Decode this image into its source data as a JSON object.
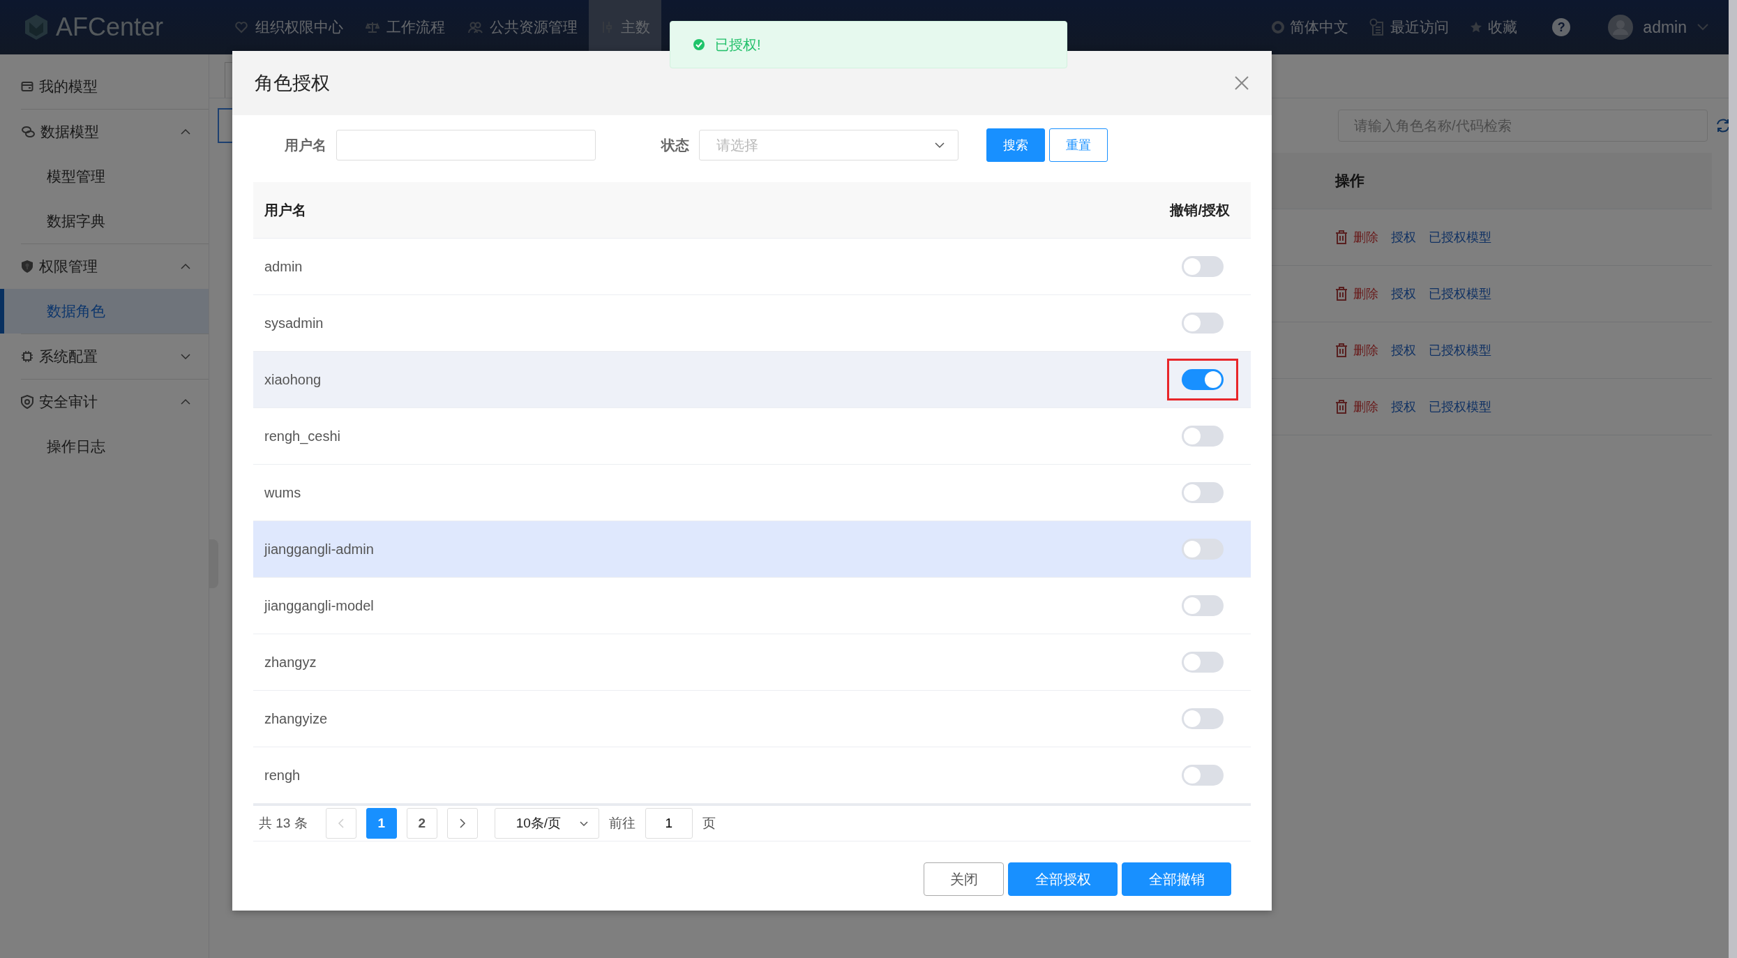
{
  "header": {
    "logo": "AFCenter",
    "nav": [
      {
        "label": "组织权限中心",
        "selected": false
      },
      {
        "label": "工作流程",
        "selected": false
      },
      {
        "label": "公共资源管理",
        "selected": false
      },
      {
        "label": "主数",
        "selected": true
      }
    ],
    "language": "简体中文",
    "recent": "最近访问",
    "favorites": "收藏",
    "help": "?",
    "user": "admin"
  },
  "sidebar": {
    "items": [
      {
        "label": "我的模型",
        "selected": false
      },
      {
        "label": "数据模型",
        "selected": false,
        "expanded": true,
        "children": [
          {
            "label": "模型管理",
            "selected": false
          },
          {
            "label": "数据字典",
            "selected": false
          }
        ]
      },
      {
        "label": "权限管理",
        "selected": false,
        "expanded": true,
        "children": [
          {
            "label": "数据角色",
            "selected": true
          }
        ]
      },
      {
        "label": "系统配置",
        "selected": false,
        "expanded": false
      },
      {
        "label": "安全审计",
        "selected": false,
        "expanded": true,
        "children": [
          {
            "label": "操作日志",
            "selected": false
          }
        ]
      }
    ]
  },
  "background_page": {
    "search": {
      "placeholder": "请输入角色名称/代码检索"
    },
    "table": {
      "columns": [
        "操作"
      ],
      "rows": [
        {
          "actions": [
            "删除",
            "授权",
            "已授权模型"
          ]
        },
        {
          "actions": [
            "删除",
            "授权",
            "已授权模型"
          ]
        },
        {
          "actions": [
            "删除",
            "授权",
            "已授权模型"
          ]
        },
        {
          "actions": [
            "删除",
            "授权",
            "已授权模型"
          ]
        }
      ]
    }
  },
  "toast": {
    "kind": "success",
    "message": "已授权!"
  },
  "dialog": {
    "title": "角色授权",
    "filters": {
      "username_label": "用户名",
      "status_label": "状态",
      "status": {
        "placeholder": "请选择"
      },
      "buttons": [
        {
          "label": "搜索",
          "kind": "primary"
        },
        {
          "label": "重置",
          "kind": "outline"
        }
      ]
    },
    "table": {
      "columns": [
        "用户名",
        "撤销/授权"
      ],
      "rows": [
        {
          "username": "admin",
          "on": false,
          "selected": false,
          "hovered": false,
          "marked": false
        },
        {
          "username": "sysadmin",
          "on": false,
          "selected": false,
          "hovered": false,
          "marked": false
        },
        {
          "username": "xiaohong",
          "on": true,
          "selected": true,
          "hovered": false,
          "marked": true
        },
        {
          "username": "rengh_ceshi",
          "on": false,
          "selected": false,
          "hovered": false,
          "marked": false
        },
        {
          "username": "wums",
          "on": false,
          "selected": false,
          "hovered": false,
          "marked": false
        },
        {
          "username": "jianggangli-admin",
          "on": false,
          "selected": false,
          "hovered": true,
          "marked": false
        },
        {
          "username": "jianggangli-model",
          "on": false,
          "selected": false,
          "hovered": false,
          "marked": false
        },
        {
          "username": "zhangyz",
          "on": false,
          "selected": false,
          "hovered": false,
          "marked": false
        },
        {
          "username": "zhangyize",
          "on": false,
          "selected": false,
          "hovered": false,
          "marked": false
        },
        {
          "username": "rengh",
          "on": false,
          "selected": false,
          "hovered": false,
          "marked": false
        }
      ]
    },
    "pagination": {
      "total": "共 13 条",
      "prev_disabled": true,
      "pages": [
        {
          "label": "1",
          "selected": true
        },
        {
          "label": "2",
          "selected": false
        }
      ],
      "page_size": "10条/页",
      "goto_label": "前往",
      "goto_value": "1",
      "page_unit": "页"
    },
    "buttons": [
      {
        "label": "关闭",
        "kind": "plain"
      },
      {
        "label": "全部授权",
        "kind": "primary"
      },
      {
        "label": "全部撤销",
        "kind": "primary"
      }
    ]
  }
}
